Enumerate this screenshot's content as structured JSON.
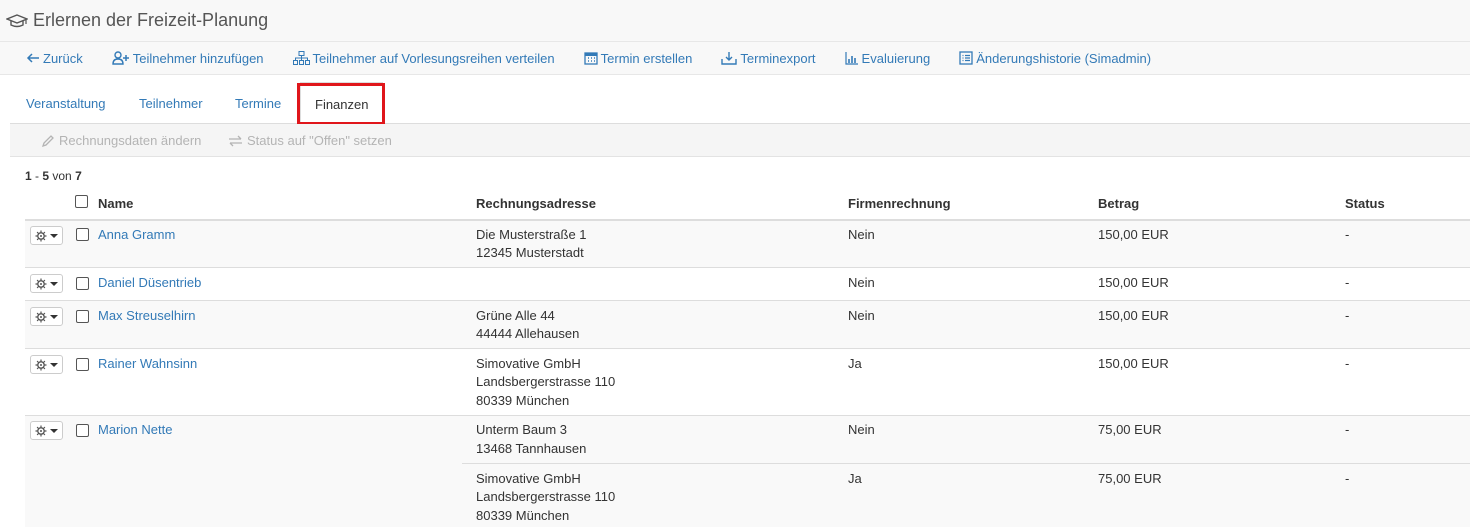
{
  "page": {
    "title": "Erlernen der Freizeit-Planung"
  },
  "toolbar": {
    "back": "Zurück",
    "add_participant": "Teilnehmer hinzufügen",
    "distribute": "Teilnehmer auf Vorlesungsreihen verteilen",
    "create_appointment": "Termin erstellen",
    "export": "Terminexport",
    "evaluation": "Evaluierung",
    "history": "Änderungshistorie (Simadmin)"
  },
  "tabs": [
    "Veranstaltung",
    "Teilnehmer",
    "Termine",
    "Finanzen"
  ],
  "active_tab": "Finanzen",
  "actions": {
    "edit_invoice": "Rechnungsdaten ändern",
    "set_status": "Status auf \"Offen\" setzen"
  },
  "pager": {
    "from": "1",
    "sep": " - ",
    "to": "5",
    "of": " von ",
    "total": "7"
  },
  "table": {
    "headers": {
      "name": "Name",
      "address": "Rechnungsadresse",
      "company": "Firmenrechnung",
      "amount": "Betrag",
      "status": "Status"
    },
    "rows": [
      {
        "name": "Anna Gramm",
        "address": [
          "Die Musterstraße 1",
          "12345 Musterstadt"
        ],
        "company": "Nein",
        "amount": "150,00 EUR",
        "status": "-"
      },
      {
        "name": "Daniel Düsentrieb",
        "address": [],
        "company": "Nein",
        "amount": "150,00 EUR",
        "status": "-"
      },
      {
        "name": "Max Streuselhirn",
        "address": [
          "Grüne Alle 44",
          "44444 Allehausen"
        ],
        "company": "Nein",
        "amount": "150,00 EUR",
        "status": "-"
      },
      {
        "name": "Rainer Wahnsinn",
        "address": [
          "Simovative GmbH",
          "Landsbergerstrasse 110",
          "80339 München"
        ],
        "company": "Ja",
        "amount": "150,00 EUR",
        "status": "-"
      },
      {
        "name": "Marion Nette",
        "address": [
          "Unterm Baum 3",
          "13468 Tannhausen"
        ],
        "company": "Nein",
        "amount": "75,00 EUR",
        "status": "-"
      },
      {
        "name": "",
        "address": [
          "Simovative GmbH",
          "Landsbergerstrasse 110",
          "80339 München"
        ],
        "company": "Ja",
        "amount": "75,00 EUR",
        "status": "-"
      }
    ]
  },
  "colors": {
    "link": "#337ab7",
    "highlight": "#e0161b",
    "disabled": "#b4b4b4"
  }
}
